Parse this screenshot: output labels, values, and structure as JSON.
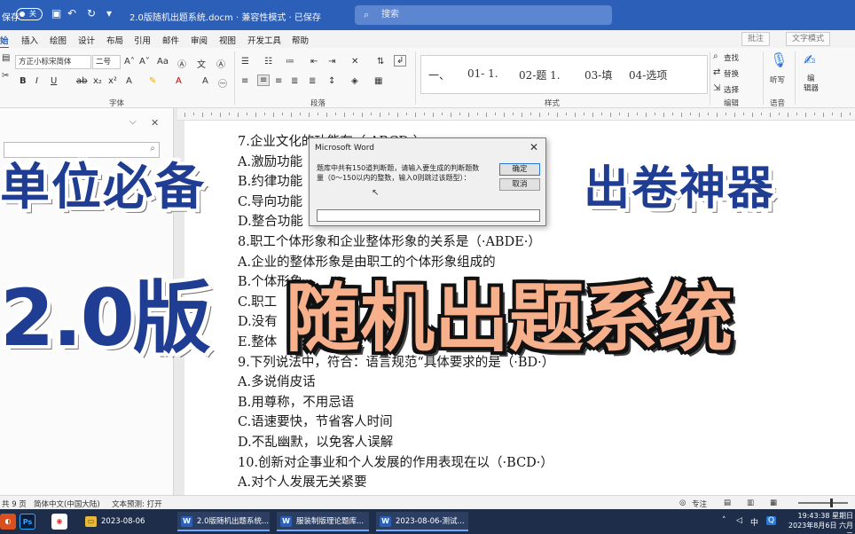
{
  "titlebar": {
    "autosave_label": "保存",
    "autosave_state": "关",
    "doc_title": "2.0版随机出题系统.docm · 兼容性模式 · 已保存",
    "search_placeholder": "搜索"
  },
  "menu": {
    "tabs": [
      "始",
      "插入",
      "绘图",
      "设计",
      "布局",
      "引用",
      "邮件",
      "审阅",
      "视图",
      "开发工具",
      "帮助"
    ],
    "comment_button": "批注",
    "edit_mode_button": "文字模式"
  },
  "ribbon": {
    "font_name": "方正小标宋简体",
    "font_size": "二号",
    "group_font": "字体",
    "group_paragraph": "段落",
    "group_styles": "样式",
    "group_editing": "编辑",
    "group_voice": "语音",
    "styles": [
      "一、",
      "01- 1.",
      "02-题 1.",
      "03-填",
      "04-选项"
    ],
    "edit_find": "查找",
    "edit_replace": "替换",
    "edit_select": "选择",
    "voice_dictate": "听写",
    "editor_line1": "编",
    "editor_line2": "辑器"
  },
  "doc_lines": [
    "7.企业文化的功能有（·ABCD·）",
    "A.激励功能",
    "B.约律功能",
    "C.导向功能",
    "D.整合功能",
    "8.职工个体形象和企业整体形象的关系是（·ABDE·）",
    "A.企业的整体形象是由职工的个体形象组成的",
    "B.个体形象",
    "C.职工",
    "D.没有",
    "E.整体",
    "9.下列说法中，符合：语言规范“具体要求的是（·BD·）",
    "A.多说俏皮话",
    "B.用尊称，不用忌语",
    "C.语速要快，节省客人时间",
    "D.不乱幽默，以免客人误解",
    "10.创新对企事业和个人发展的作用表现在以（·BCD·）",
    "A.对个人发展无关紧要"
  ],
  "overlay": {
    "unit_must_have": "单位必备",
    "exam_tool": "出卷神器",
    "version": "2.0版",
    "system": "随机出题系统"
  },
  "dialog": {
    "title": "Microsoft Word",
    "message": "题库中共有150道判断题，请输入要生成的判断题数量（0～150以内的整数，输入0则跳过该题型）：",
    "ok_label": "确定",
    "cancel_label": "取消",
    "input_value": ""
  },
  "status": {
    "pages": "共 9 页",
    "language": "简体中文(中国大陆)",
    "prediction": "文本预测: 打开",
    "focus": "专注"
  },
  "taskbar": {
    "tasks": [
      "2023-08-06",
      "2.0版随机出题系统...",
      "服装制版理论题库...",
      "2023-08-06-测试..."
    ],
    "ime_cn": "中",
    "time": "19:43:38 星期日",
    "date": "2023年8月6日 六月二"
  }
}
